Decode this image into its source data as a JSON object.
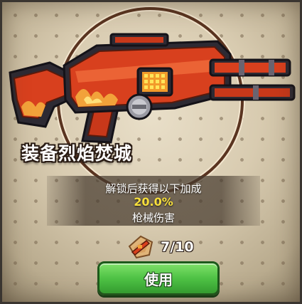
{
  "item": {
    "name": "装备烈焰焚城",
    "icon": "flame-rifle-weapon-icon"
  },
  "unlock": {
    "description": "解锁后获得以下加成",
    "bonus_value": "20.0%",
    "bonus_type": "枪械伤害"
  },
  "fragments": {
    "icon": "weapon-fragment-icon",
    "count": "7/10",
    "collected": 7,
    "required": 10
  },
  "actions": {
    "use_label": "使用"
  },
  "colors": {
    "accent_yellow": "#f7df3c",
    "button_green": "#4fc446",
    "weapon_red": "#d8401e"
  }
}
